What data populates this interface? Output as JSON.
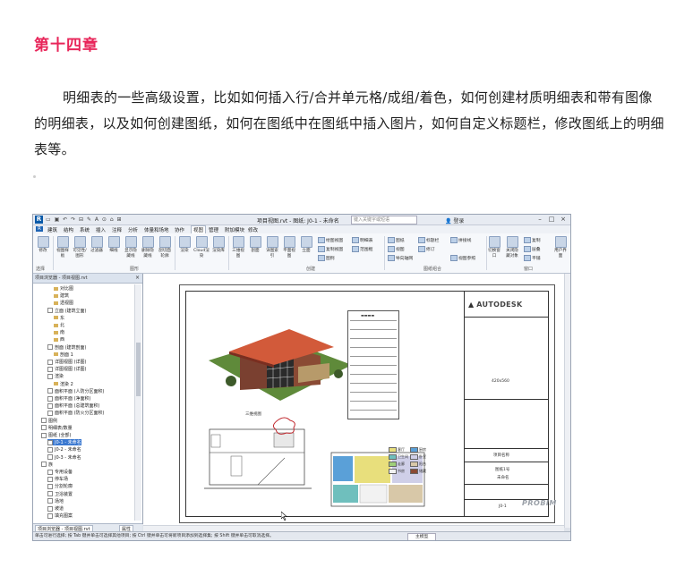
{
  "heading": "第十四章",
  "paragraph": "明细表的一些高级设置，比如如何插入行/合并单元格/成组/着色，如何创建材质明细表和带有图像的明细表，以及如何创建图纸，如何在图纸中在图纸中插入图片，如何自定义标题栏，修改图纸上的明细表等。",
  "screenshot": {
    "window_title": "项目视图.rvt - 图纸: J0-1 - 未命名",
    "search_placeholder": "键入关键字或短语",
    "login": "登录",
    "menu": [
      "建筑",
      "结构",
      "系统",
      "插入",
      "注释",
      "分析",
      "体量和场地",
      "协作",
      "视图",
      "管理",
      "附加模块",
      "修改"
    ],
    "active_menu": "视图",
    "ribbon": {
      "select_label": "修改",
      "select_group": "选择",
      "graphics_buttons": [
        "视图样板",
        "可见性/图形",
        "过滤器",
        "细线",
        "显示隐藏线",
        "删除隐藏线",
        "剖切面轮廓"
      ],
      "graphics_group": "图形",
      "render_buttons": [
        "渲染",
        "Cloud渲染",
        "渲染库"
      ],
      "create_buttons": [
        "三维视图",
        "剖面",
        "详图索引",
        "平面视图",
        "立面",
        "绘图视图",
        "复制视图",
        "图例",
        "明细表",
        "范围框"
      ],
      "create_group": "创建",
      "sheet_buttons": [
        "图纸",
        "标题栏",
        "修订",
        "导向轴网",
        "视图",
        "拼接线",
        "视图参照"
      ],
      "sheet_group": "图纸组合",
      "window_buttons": [
        "切换窗口",
        "关闭隐藏对象",
        "复制",
        "层叠",
        "平铺",
        "用户界面"
      ],
      "window_group": "窗口"
    },
    "project_browser": {
      "title": "项目浏览器 - 项目视图.rvt",
      "items": [
        "对比图",
        "建筑",
        "透视图",
        "立面 (建筑立面)",
        "东",
        "北",
        "南",
        "西",
        "剖面 (建筑剖面)",
        "剖面 1",
        "详图视图 (详图)",
        "详图视图 (详图)",
        "渲染",
        "渲染 2",
        "面积平面 (人防分区面积)",
        "面积平面 (净面积)",
        "面积平面 (总建筑面积)",
        "面积平面 (防火分区面积)",
        "图例",
        "明细表/数量",
        "图纸 (全部)",
        "J0-1 - 未命名",
        "J0-2 - 未命名",
        "J0-3 - 未命名",
        "族",
        "专用设备",
        "停车场",
        "分割轮廓",
        "卫浴装置",
        "场地",
        "坡道",
        "填充图案"
      ],
      "selected_index": 21,
      "tabs": [
        "项目浏览器 - 项目视图.rvt",
        "属性"
      ]
    },
    "sheet": {
      "titleblock_logo": "AUTODESK",
      "size_label": "420x560",
      "project_label": "项目名称",
      "sheet_name": "未命名",
      "sheet_no": "J0-1",
      "sheet_role": "图纸1号",
      "view_label": "三维视图",
      "legend": [
        "客厅",
        "厨房",
        "卫生间",
        "卧室",
        "走廊",
        "阳台",
        "书房",
        "储藏"
      ]
    },
    "status_text": "单击可进行选择; 按 Tab 键并单击可选择其他项目; 按 Ctrl 键并单击可将新项目添加到选择集; 按 Shift 键并单击可取消选择。",
    "status_model": "主模型",
    "watermark": "PROBIM"
  }
}
